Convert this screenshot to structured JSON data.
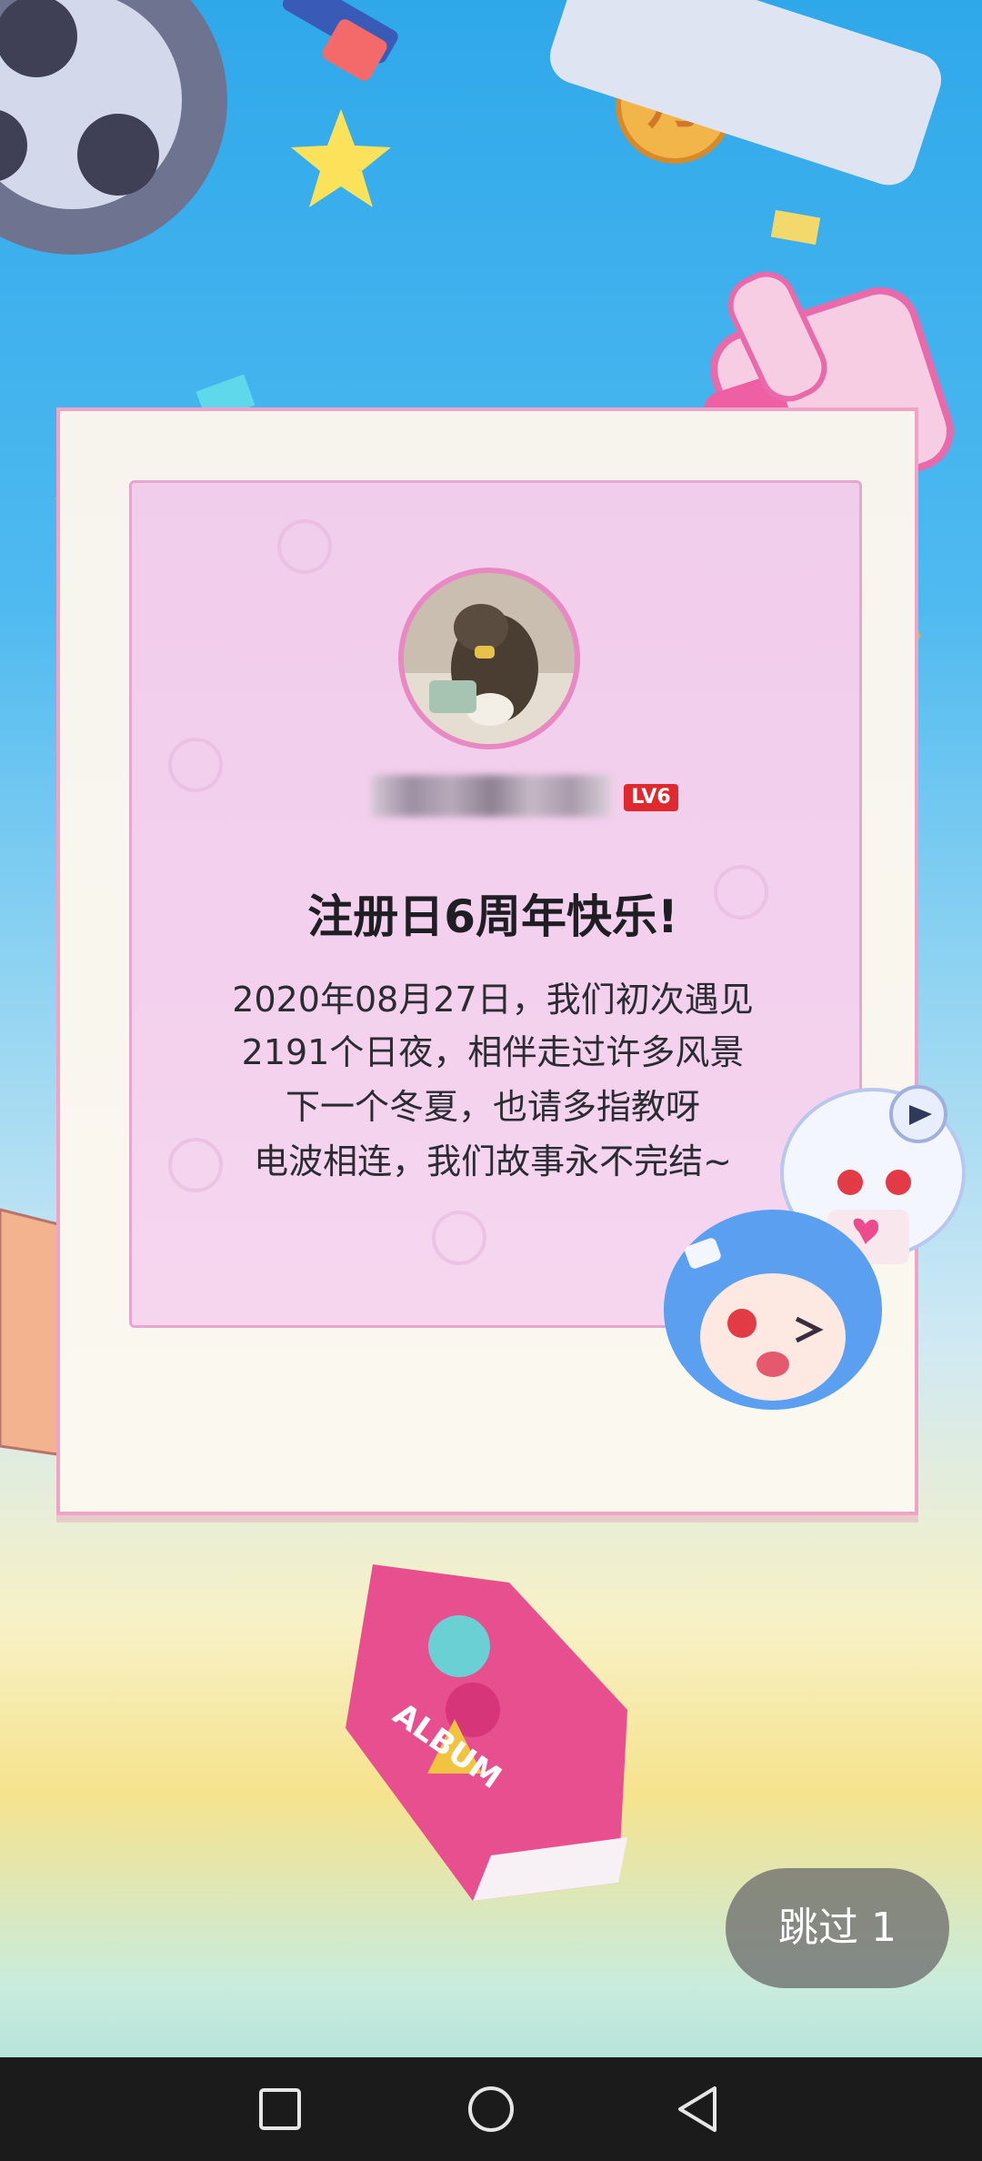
{
  "card": {
    "level": "LV6",
    "title": "注册日6周年快乐!",
    "message_lines": [
      "2020年08月27日，我们初次遇见",
      "2191个日夜，相伴走过许多风景",
      "下一个冬夏，也请多指教呀",
      "电波相连，我们故事永不完结~"
    ]
  },
  "skip_button": {
    "label": "跳过 1"
  },
  "album": {
    "label": "ALBUM"
  },
  "colors": {
    "card_border": "#f0a3c6",
    "card_inner": "#f1cdec",
    "level_badge": "#e0282f",
    "navbar": "#1b1b1b"
  },
  "icons": {
    "nav_recent": "square-icon",
    "nav_home": "circle-icon",
    "nav_back": "triangle-back-icon"
  }
}
